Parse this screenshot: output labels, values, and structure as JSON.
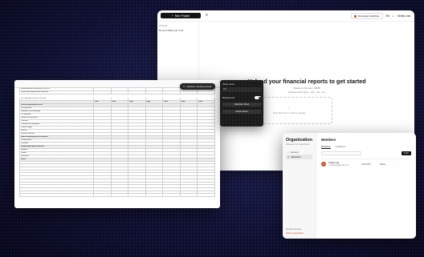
{
  "app": {
    "new_project_label": "New Project",
    "download_label": "Download Cashflow",
    "user_label": "Ondey Lisa",
    "lang_label": "EN",
    "sidebar_heading": "Projects",
    "sidebar_item": "Бк за 9 2025 для Ч 52",
    "upload_title": "Upload your financial reports to get started",
    "upload_sub1": "Maximum file size: 50MB",
    "upload_sub2": "Accepted file types: .xlsx, .xls, .csv",
    "dropzone_text": "Drop files here or click to upload"
  },
  "sheet": {
    "replace_label": "Replace existing blocks",
    "header_line1": "Наименование показателя: КЦР/ЕО",
    "header_line2": "Параметры финансового проекта",
    "header_line3": "тыс. рублей в расчете без НДС",
    "col_headers": [
      "Янв",
      "Фев",
      "Мар",
      "Апр",
      "Май",
      "Июн",
      "Июл"
    ],
    "rows": [
      "Чистый денежный поток",
      "Поступления",
      "Выручка от реализации",
      "От продажи",
      "Прочие поступления",
      "Платежи",
      "Платежи поставщикам",
      "Оплата труда",
      "Налоги",
      "Прочие платежи",
      "Инвестиционная деятельность",
      "Поступления",
      "Платежи",
      "Финансовая деятельность",
      "Кредиты",
      "Займы",
      "Проценты",
      "Итого"
    ]
  },
  "panel": {
    "title": "Sheet name",
    "field_value": "CF",
    "toggle_label": "Background",
    "btn1": "Duplicate Sheet",
    "btn2": "Delete Sheet"
  },
  "org": {
    "title": "Organization",
    "subtitle": "Manage your organization",
    "nav": [
      "General",
      "Members"
    ],
    "foot_line1": "Invoices & plans",
    "foot_line2": "Delete organization",
    "members_heading": "Members",
    "tabs": [
      "Members",
      "Invitations"
    ],
    "invite_label": "Invite",
    "member_initial": "O",
    "member_name": "Ondey Lisa",
    "member_email": "ondeylisa@gmail.com",
    "member_date": "4/15/2025",
    "member_role": "Admin"
  }
}
